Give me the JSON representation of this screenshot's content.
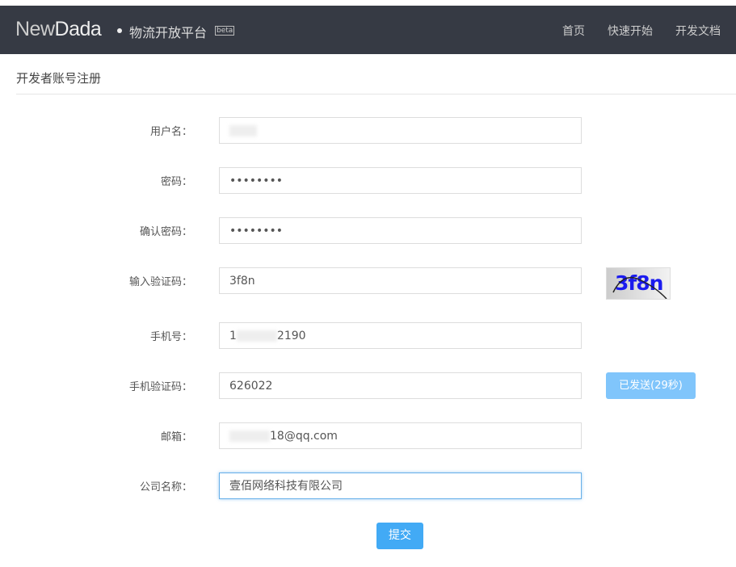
{
  "header": {
    "logo_new": "New",
    "logo_dada": "Dada",
    "platform": "物流开放平台",
    "beta": "beta",
    "nav": [
      "首页",
      "快速开始",
      "开发文档"
    ]
  },
  "page_title": "开发者账号注册",
  "form": {
    "username": {
      "label": "用户名：",
      "value": ""
    },
    "password": {
      "label": "密码：",
      "value": "••••••••"
    },
    "confirm": {
      "label": "确认密码：",
      "value": "••••••••"
    },
    "captcha": {
      "label": "输入验证码：",
      "value": "3f8n",
      "image_text": "3f8n"
    },
    "phone": {
      "label": "手机号：",
      "prefix": "1",
      "suffix": "2190"
    },
    "sms": {
      "label": "手机验证码：",
      "value": "626022",
      "button": "已发送(29秒)"
    },
    "email": {
      "label": "邮箱：",
      "suffix": "18@qq.com"
    },
    "company": {
      "label": "公司名称：",
      "value": "壹佰网络科技有限公司"
    },
    "submit": "提交"
  }
}
